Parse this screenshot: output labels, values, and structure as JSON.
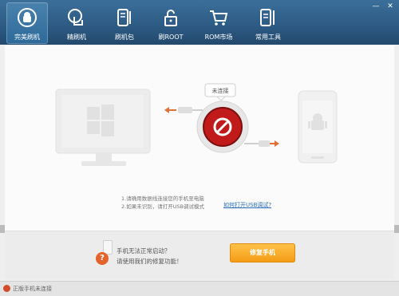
{
  "toolbar": {
    "items": [
      {
        "label": "完美刷机",
        "icon": "android-refresh-icon"
      },
      {
        "label": "精刷机",
        "icon": "touch-icon"
      },
      {
        "label": "刷机包",
        "icon": "phone-tools-icon"
      },
      {
        "label": "刷ROOT",
        "icon": "unlock-icon"
      },
      {
        "label": "ROM市场",
        "icon": "cart-icon"
      },
      {
        "label": "常用工具",
        "icon": "phone-wrench-icon"
      }
    ]
  },
  "window": {
    "minimize": "—",
    "close": "✕"
  },
  "connection": {
    "status_bubble": "未连接"
  },
  "instructions": {
    "line1": "1.请确用数据线连接您的手机至电脑",
    "line2": "2.如果未识别，请打开USB调试模式",
    "link": "如何打开USB调试?"
  },
  "help": {
    "line1": "手机无法正常启动？",
    "line2": "请使用我们的修复功能！",
    "button": "修复手机"
  },
  "statusbar": {
    "text": "正版手机未连接"
  },
  "colors": {
    "toolbar": "#2c5a83",
    "accent": "#f7a21b",
    "stop": "#c11a1a"
  }
}
